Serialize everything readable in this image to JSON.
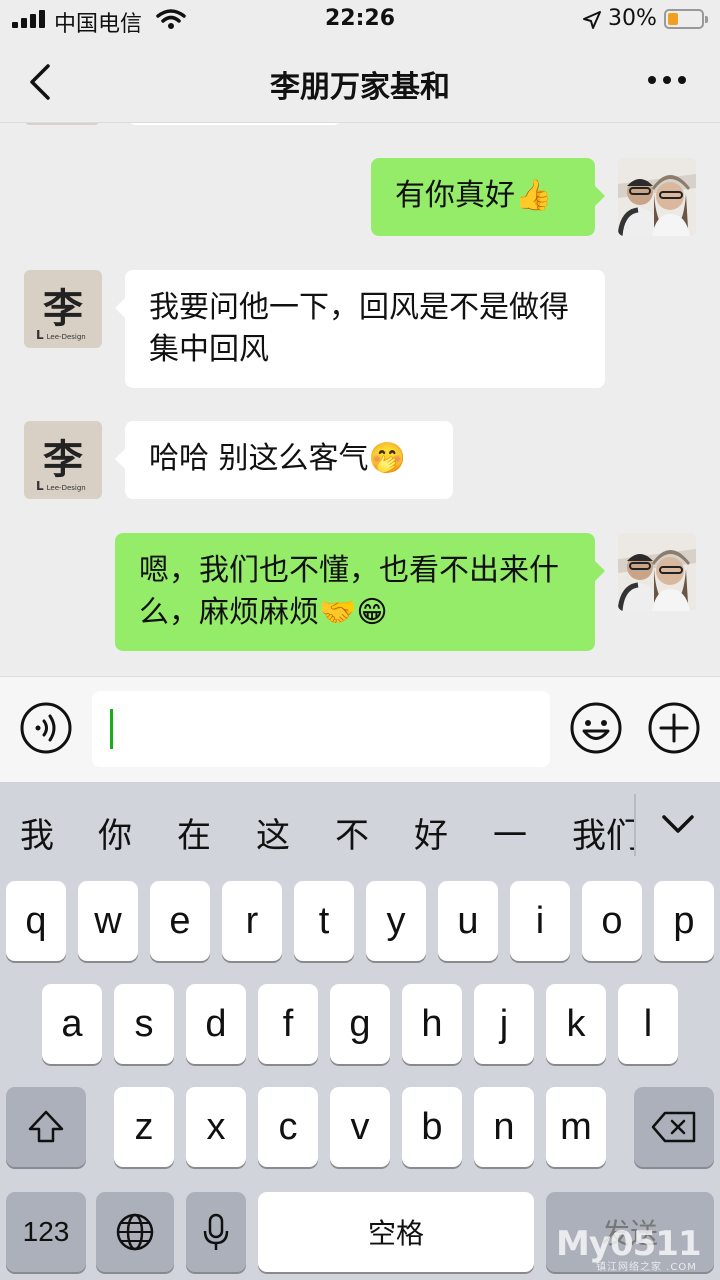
{
  "status_bar": {
    "carrier": "中国电信",
    "time": "22:26",
    "battery_percent": "30%",
    "battery_level": 0.3,
    "icons": [
      "signal-icon",
      "wifi-icon",
      "location-icon",
      "battery-icon"
    ]
  },
  "nav": {
    "title": "李朋万家基和",
    "icons": [
      "back-chevron-icon",
      "more-dots-icon"
    ]
  },
  "messages": [
    {
      "side": "right",
      "text": "有你真好👍",
      "sender": "me"
    },
    {
      "side": "left",
      "text": "我要问他一下，回风是不是做得集中回风",
      "sender": "李朋"
    },
    {
      "side": "left",
      "text": "哈哈 别这么客气🤭",
      "sender": "李朋"
    },
    {
      "side": "right",
      "text": "嗯，我们也不懂，也看不出来什么，麻烦麻烦🤝😁",
      "sender": "me"
    }
  ],
  "contact_avatar": {
    "char": "李",
    "brand_mark": "L",
    "brand_text": "Lee-Design"
  },
  "input": {
    "value": "",
    "icons": [
      "voice-icon",
      "emoji-icon",
      "plus-icon"
    ]
  },
  "keyboard": {
    "candidates": [
      "我",
      "你",
      "在",
      "这",
      "不",
      "好",
      "一",
      "我们"
    ],
    "row1": [
      "q",
      "w",
      "e",
      "r",
      "t",
      "y",
      "u",
      "i",
      "o",
      "p"
    ],
    "row2": [
      "a",
      "s",
      "d",
      "f",
      "g",
      "h",
      "j",
      "k",
      "l"
    ],
    "row3": [
      "z",
      "x",
      "c",
      "v",
      "b",
      "n",
      "m"
    ],
    "num_key": "123",
    "space_key": "空格",
    "send_key": "发送",
    "icons": [
      "chevron-down-icon",
      "shift-icon",
      "backspace-icon",
      "globe-icon",
      "mic-icon"
    ]
  },
  "watermark": {
    "text": "My0511",
    "sub": "镇江网络之家 .COM"
  }
}
